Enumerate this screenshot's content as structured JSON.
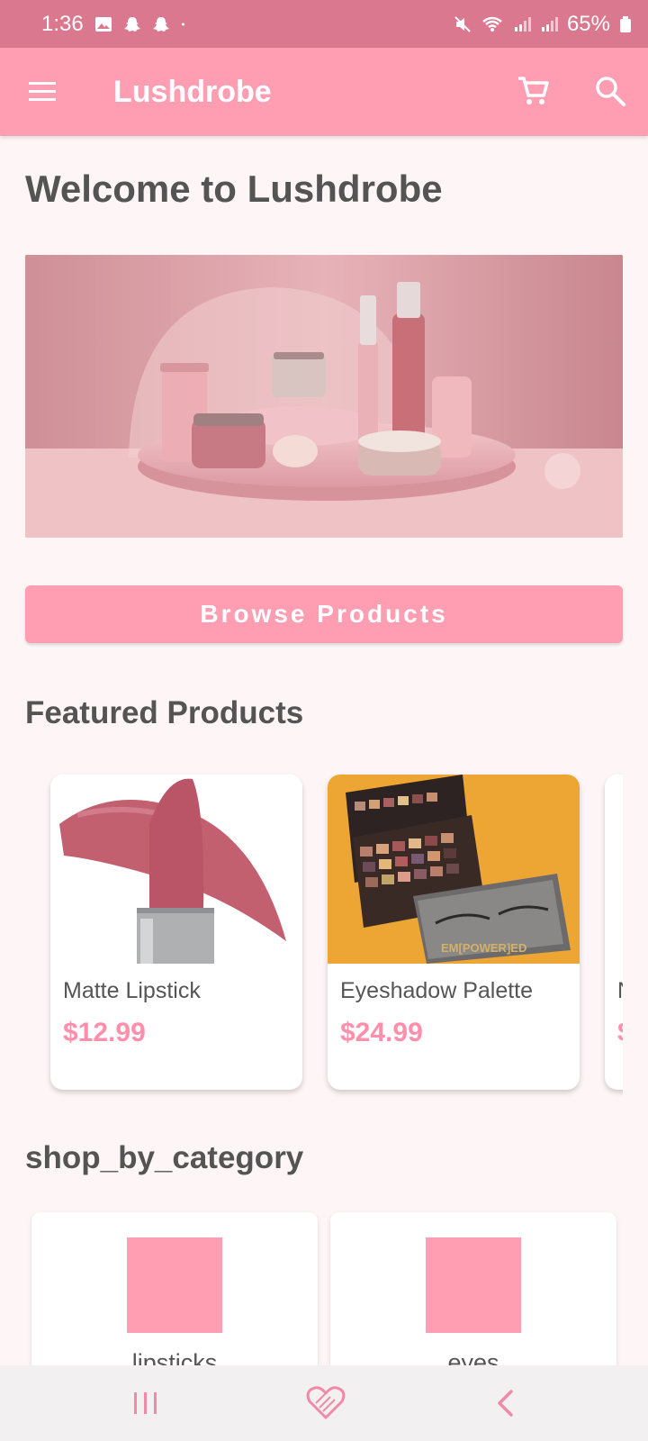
{
  "status_bar": {
    "time": "1:36",
    "battery": "65%"
  },
  "app_bar": {
    "title": "Lushdrobe",
    "menu_icon": "menu-icon",
    "cart_icon": "cart-icon",
    "search_icon": "search-icon"
  },
  "home": {
    "welcome": "Welcome to Lushdrobe",
    "browse_button": "Browse Products",
    "featured_title": "Featured Products",
    "category_title": "shop_by_category"
  },
  "featured_products": [
    {
      "name": "Matte Lipstick",
      "price": "$12.99"
    },
    {
      "name": "Eyeshadow Palette",
      "price": "$24.99"
    },
    {
      "name": "N",
      "price": "$"
    }
  ],
  "categories": [
    {
      "label": "lipsticks"
    },
    {
      "label": "eyes"
    }
  ],
  "colors": {
    "primary": "#ff9db2",
    "status_bar": "#d9788f",
    "background": "#fdf5f6",
    "price": "#ff8fab",
    "nav_icons": "#f08aa6"
  }
}
